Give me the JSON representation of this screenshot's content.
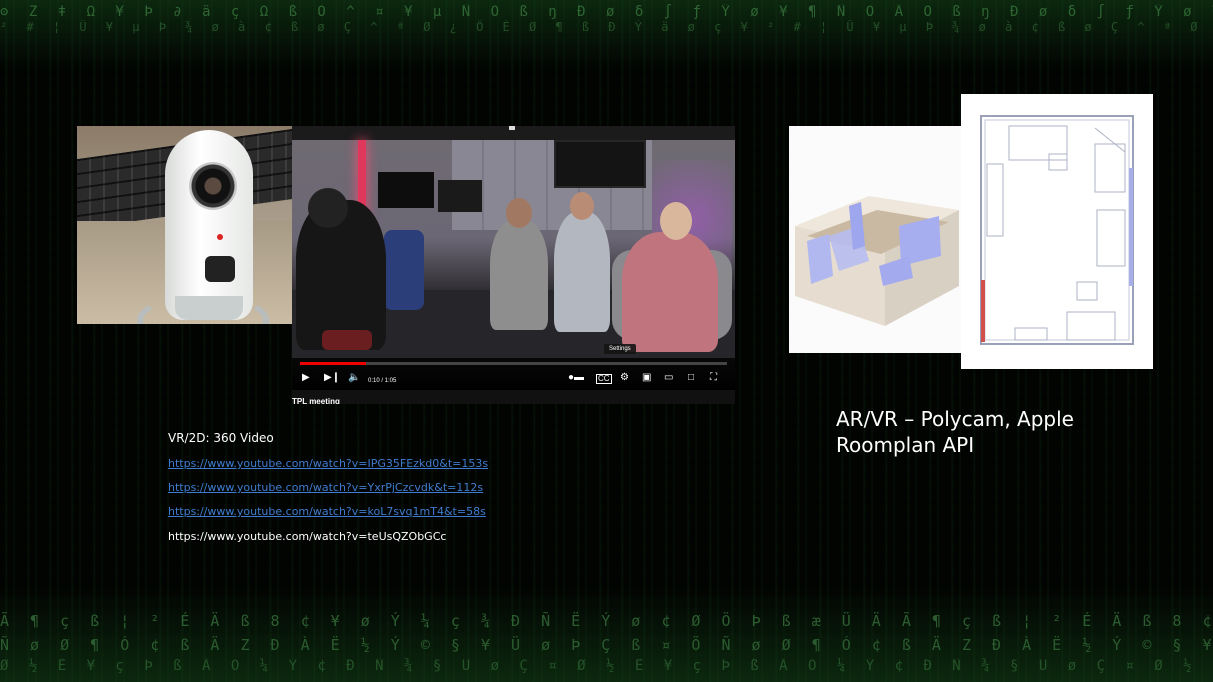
{
  "video": {
    "time": "0:10 / 1:05",
    "progress": 0.154,
    "settings_tooltip": "Settings",
    "title": "TPL meeting"
  },
  "text": {
    "vr_heading": "VR/2D: 360 Video",
    "links": [
      "https://www.youtube.com/watch?v=IPG35FEzkd0&t=153s",
      "https://www.youtube.com/watch?v=YxrPjCzcvdk&t=112s",
      "https://www.youtube.com/watch?v=koL7svq1mT4&t=58s",
      "https://www.youtube.com/watch?v=teUsQZObGCc"
    ],
    "ar_heading": "AR/VR  –  Polycam,  Apple Roomplan API"
  },
  "colors": {
    "background": "#020402",
    "matrix_green": "#4c9a52",
    "link": "#3f7ccf",
    "progress": "#e00000"
  },
  "icons": {
    "play": "play-icon",
    "next": "next-icon",
    "volume": "volume-icon",
    "autoplay": "autoplay-toggle-icon",
    "captions": "captions-icon",
    "settings": "gear-icon",
    "miniplayer": "miniplayer-icon",
    "theater": "theater-icon",
    "cast": "cast-icon",
    "fullscreen": "fullscreen-icon"
  }
}
